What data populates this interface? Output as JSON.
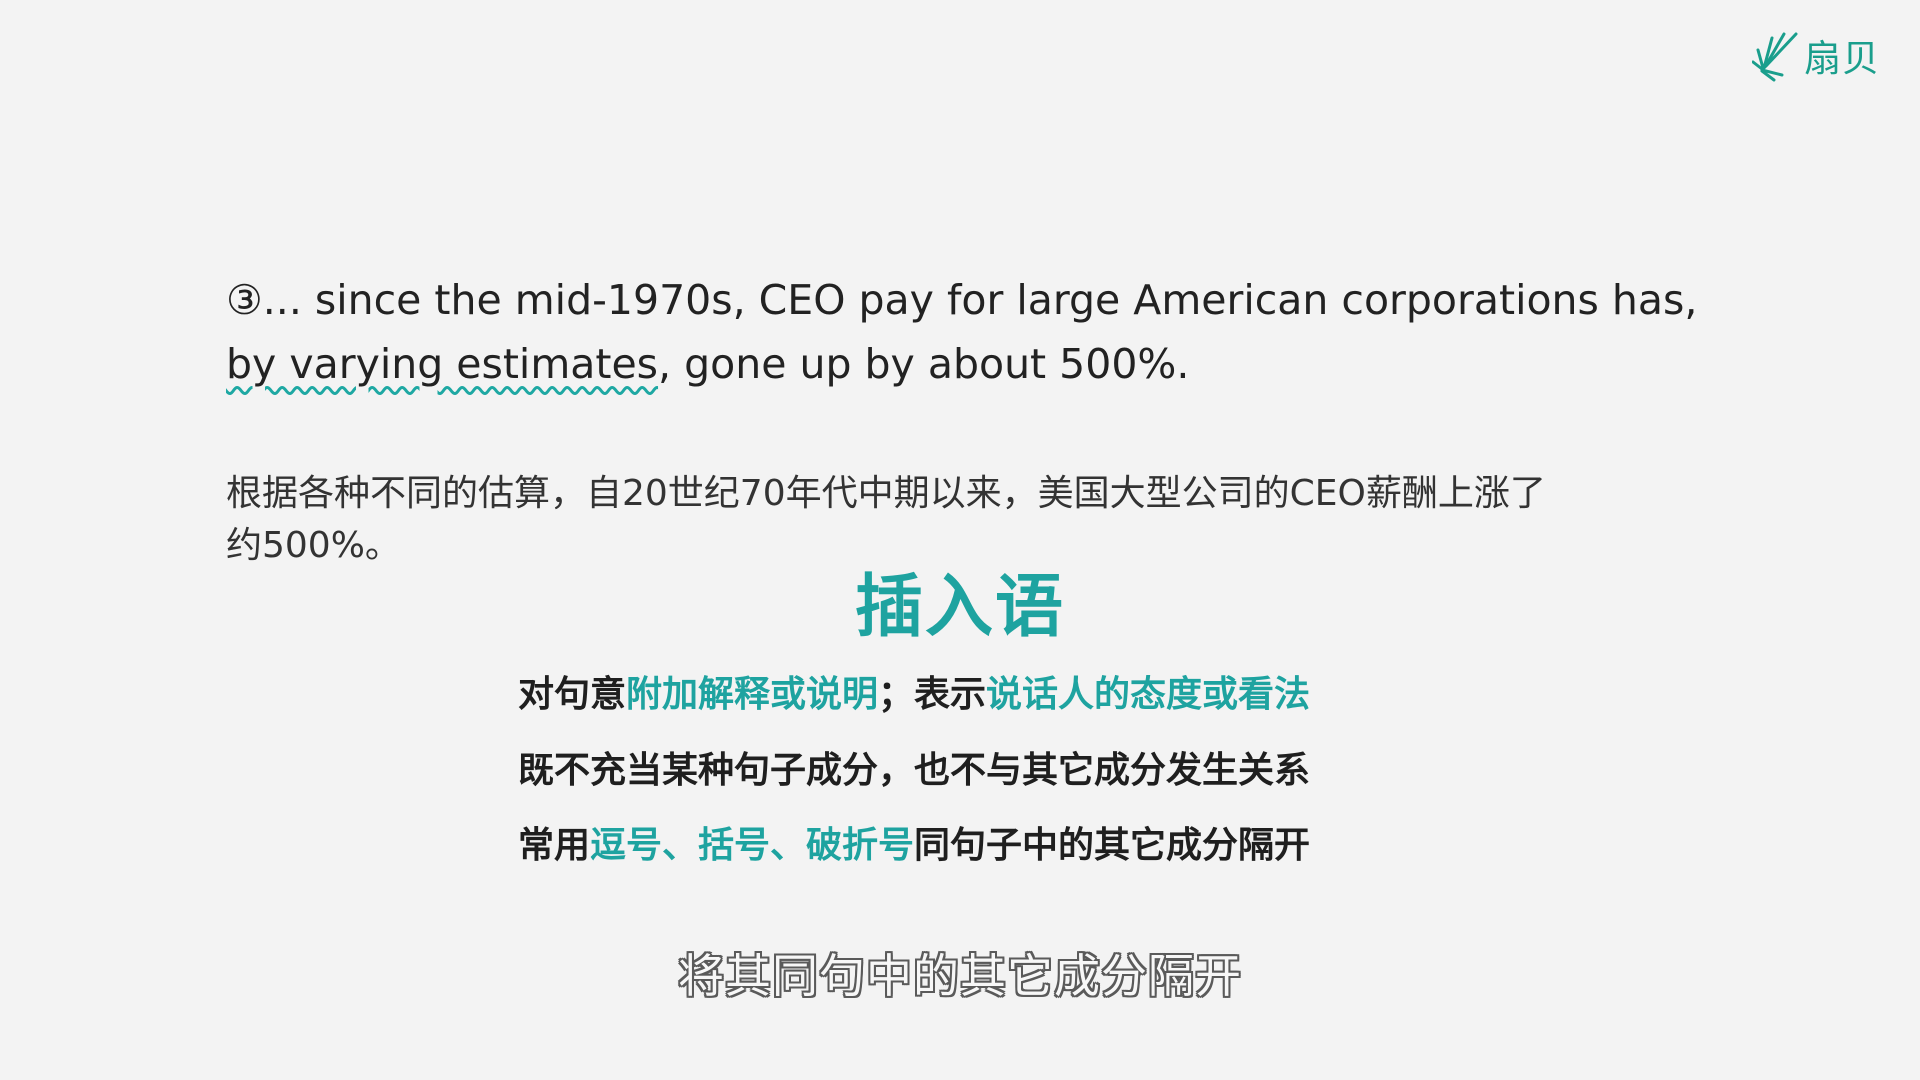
{
  "brand": {
    "logo_icon": "fan-rays-icon",
    "name": "扇贝",
    "color": "#1a9e8c"
  },
  "example": {
    "line1": "③... since the mid-1970s, CEO pay for large American corporations has,",
    "line2_highlight": "by varying estimates",
    "line2_rest": ", gone up by about 500%."
  },
  "translation": {
    "line1": "根据各种不同的估算，自20世纪70年代中期以来，美国大型公司的CEO薪酬上涨了",
    "line2": "约500%。"
  },
  "concept": {
    "title": "插入语",
    "line1": {
      "p1": "对句意",
      "h1": "附加解释或说明",
      "p2": "；表示",
      "h2": "说话人的态度或看法"
    },
    "line2": "既不充当某种句子成分，也不与其它成分发生关系",
    "line3": {
      "p1": "常用",
      "h1": "逗号、括号、破折号",
      "p2": "同句子中的其它成分隔开"
    }
  },
  "subtitle": "将其同句中的其它成分隔开",
  "colors": {
    "accent": "#1ea3a0",
    "background": "#f3f3f3",
    "text": "#222222"
  }
}
